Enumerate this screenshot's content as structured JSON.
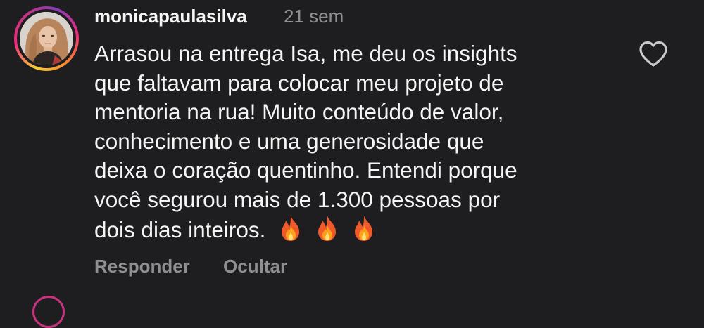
{
  "comment": {
    "username": "monicapaulasilva",
    "time": "21 sem",
    "text_lines": [
      "Arrasou na entrega Isa, me deu os insights",
      "que faltavam para colocar meu projeto de",
      "mentoria na rua! Muito conteúdo de valor,",
      "conhecimento e uma generosidade que",
      "deixa o coração quentinho. Entendi porque",
      "você segurou mais de 1.300 pessoas por",
      "dois dias inteiros."
    ],
    "emojis": [
      "fire-emoji",
      "fire-emoji",
      "fire-emoji"
    ],
    "actions": {
      "reply_label": "Responder",
      "hide_label": "Ocultar"
    },
    "like_icon": "heart-outline-icon"
  },
  "colors": {
    "background": "#1e1e20",
    "text": "#f5f5f5",
    "muted": "#8e8e93",
    "story_ring_start": "#f9ce34",
    "story_ring_mid": "#ee2a7b",
    "story_ring_end": "#8a3ab9"
  }
}
